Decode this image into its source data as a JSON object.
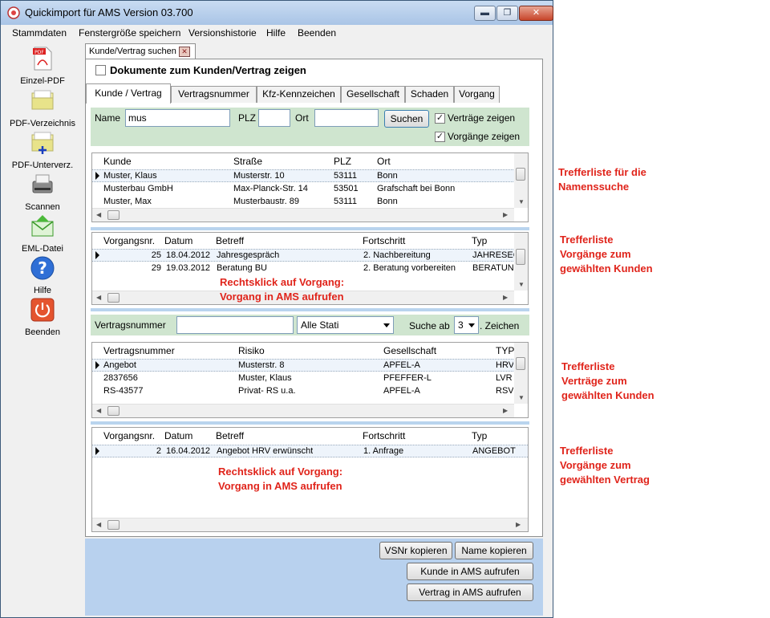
{
  "window": {
    "title": "Quickimport für AMS Version 03.700",
    "controls": {
      "minimize": "▬",
      "maximize": "❐",
      "close": "✕"
    }
  },
  "menu": [
    "Stammdaten",
    "Fenstergröße speichern",
    "Versionshistorie",
    "Hilfe",
    "Beenden"
  ],
  "sidebar": [
    {
      "label": "Einzel-PDF",
      "icon": "pdf-icon"
    },
    {
      "label": "PDF-Verzeichnis",
      "icon": "folder-icon"
    },
    {
      "label": "PDF-Unterverz.",
      "icon": "folder-add-icon"
    },
    {
      "label": "Scannen",
      "icon": "scanner-icon"
    },
    {
      "label": "EML-Datei",
      "icon": "email-icon"
    },
    {
      "label": "Hilfe",
      "icon": "help-icon"
    },
    {
      "label": "Beenden",
      "icon": "power-icon"
    }
  ],
  "outer_tab": {
    "label": "Kunde/Vertrag suchen",
    "close": "✕"
  },
  "docs_checkbox": {
    "label": "Dokumente zum Kunden/Vertrag zeigen",
    "checked": false
  },
  "tabs": [
    "Kunde / Vertrag",
    "Vertragsnummer",
    "Kfz-Kennzeichen",
    "Gesellschaft",
    "Schaden",
    "Vorgang"
  ],
  "search": {
    "name_label": "Name",
    "name_value": "mus",
    "plz_label": "PLZ",
    "plz_value": "",
    "ort_label": "Ort",
    "ort_value": "",
    "button": "Suchen",
    "check_contracts": "Verträge zeigen",
    "check_processes": "Vorgänge zeigen",
    "check_mark": "✓"
  },
  "customers": {
    "headers": [
      "Kunde",
      "Straße",
      "PLZ",
      "Ort"
    ],
    "rows": [
      [
        "Muster, Klaus",
        "Musterstr. 10",
        "53111",
        "Bonn"
      ],
      [
        "Musterbau GmbH",
        "Max-Planck-Str. 14",
        "53501",
        "Grafschaft bei Bonn"
      ],
      [
        "Muster, Max",
        "Musterbaustr. 89",
        "53111",
        "Bonn"
      ]
    ]
  },
  "processes_customer": {
    "headers": [
      "Vorgangsnr.",
      "Datum",
      "Betreff",
      "Fortschritt",
      "Typ"
    ],
    "rows": [
      [
        "25",
        "18.04.2012",
        "Jahresgespräch",
        "2. Nachbereitung",
        "JAHRESEG"
      ],
      [
        "29",
        "19.03.2012",
        "Beratung BU",
        "2. Beratung vorbereiten",
        "BERATUNG"
      ]
    ],
    "annotation_line1": "Rechtsklick auf Vorgang:",
    "annotation_line2": "Vorgang in AMS aufrufen"
  },
  "contract_filter": {
    "label": "Vertragsnummer",
    "value": "",
    "status_select": "Alle Stati",
    "search_from_label": "Suche ab",
    "search_from_value": "3",
    "chars_label": ". Zeichen"
  },
  "contracts": {
    "headers": [
      "Vertragsnummer",
      "Risiko",
      "Gesellschaft",
      "TYP"
    ],
    "rows": [
      [
        "Angebot",
        "Musterstr. 8",
        "APFEL-A",
        "HRV"
      ],
      [
        "2837656",
        "Muster, Klaus",
        "PFEFFER-L",
        "LVR"
      ],
      [
        "RS-43577",
        "Privat- RS u.a.",
        "APFEL-A",
        "RSV"
      ]
    ]
  },
  "processes_contract": {
    "headers": [
      "Vorgangsnr.",
      "Datum",
      "Betreff",
      "Fortschritt",
      "Typ"
    ],
    "rows": [
      [
        "2",
        "16.04.2012",
        "Angebot HRV erwünscht",
        "1. Anfrage",
        "ANGEBOT"
      ]
    ],
    "annotation_line1": "Rechtsklick auf Vorgang:",
    "annotation_line2": "Vorgang in AMS aufrufen"
  },
  "buttons": {
    "copy_vsnr": "VSNr kopieren",
    "copy_name": "Name kopieren",
    "open_customer": "Kunde in AMS aufrufen",
    "open_contract": "Vertrag in AMS aufrufen"
  },
  "annotations": {
    "a1": [
      "Trefferliste für die",
      "Namenssuche"
    ],
    "a2": [
      "Trefferliste",
      "Vorgänge zum",
      "gewählten Kunden"
    ],
    "a3": [
      "Trefferliste",
      "Verträge zum",
      "gewählten Kunden"
    ],
    "a4": [
      "Trefferliste",
      "Vorgänge zum",
      "gewählten Vertrag"
    ]
  },
  "colors": {
    "accent_green": "#cfe5cf",
    "accent_blue": "#b8d1ee",
    "annotation_red": "#e0241b"
  }
}
